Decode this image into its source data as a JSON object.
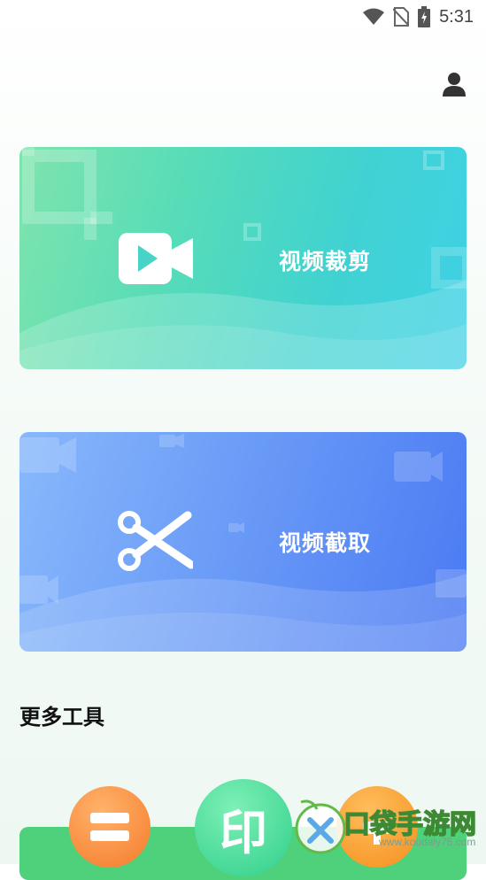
{
  "status_bar": {
    "time": "5:31",
    "icons": [
      "wifi-icon",
      "no-sim-icon",
      "battery-charging-icon"
    ]
  },
  "header": {
    "profile_icon": "person-icon"
  },
  "cards": [
    {
      "label": "视频裁剪",
      "icon": "video-camera-icon"
    },
    {
      "label": "视频截取",
      "icon": "scissors-icon"
    }
  ],
  "more_tools": {
    "title": "更多工具",
    "items": [
      {
        "icon": "minus-bars-icon"
      },
      {
        "glyph": "印"
      },
      {
        "icon": "stamp-icon"
      }
    ]
  },
  "watermark": {
    "text": "口袋手游网",
    "url": "www.koudaly75.com"
  },
  "colors": {
    "card_crop_gradient": [
      "#7fe4ad",
      "#3fd1e6"
    ],
    "card_clip_gradient": [
      "#88b8fb",
      "#4b7af3"
    ],
    "tool_orange": "#f57a2a",
    "tool_green": "#2fcf8b",
    "strip_green": "#4fd07b"
  }
}
